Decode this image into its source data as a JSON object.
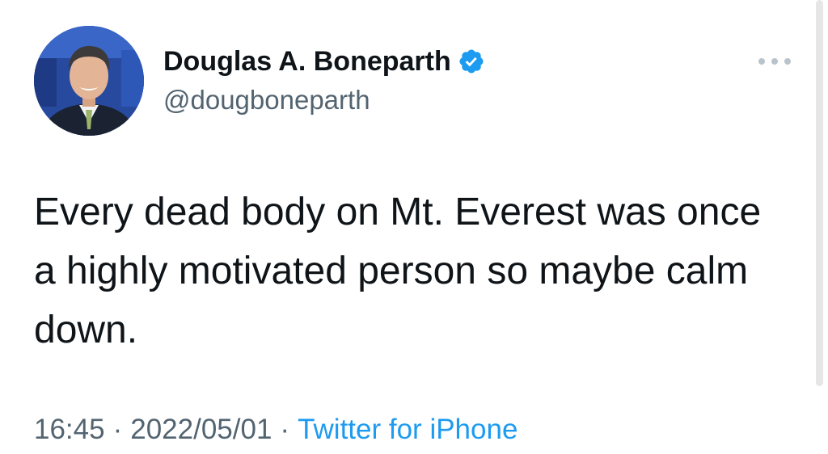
{
  "tweet": {
    "author": {
      "display_name": "Douglas A. Boneparth",
      "handle": "@dougboneparth",
      "verified": true,
      "verified_icon": "verified-badge-icon"
    },
    "text": "Every dead body on Mt. Everest was once a highly motivated person so maybe calm down.",
    "time": "16:45",
    "date": "2022/05/01",
    "separator": "·",
    "source": "Twitter for iPhone"
  },
  "icons": {
    "more": "more-options-icon",
    "verified": "verified-badge-icon"
  },
  "colors": {
    "text_primary": "#0f1419",
    "text_secondary": "#536471",
    "link": "#1d9bf0",
    "verified_badge": "#1d9bf0"
  }
}
